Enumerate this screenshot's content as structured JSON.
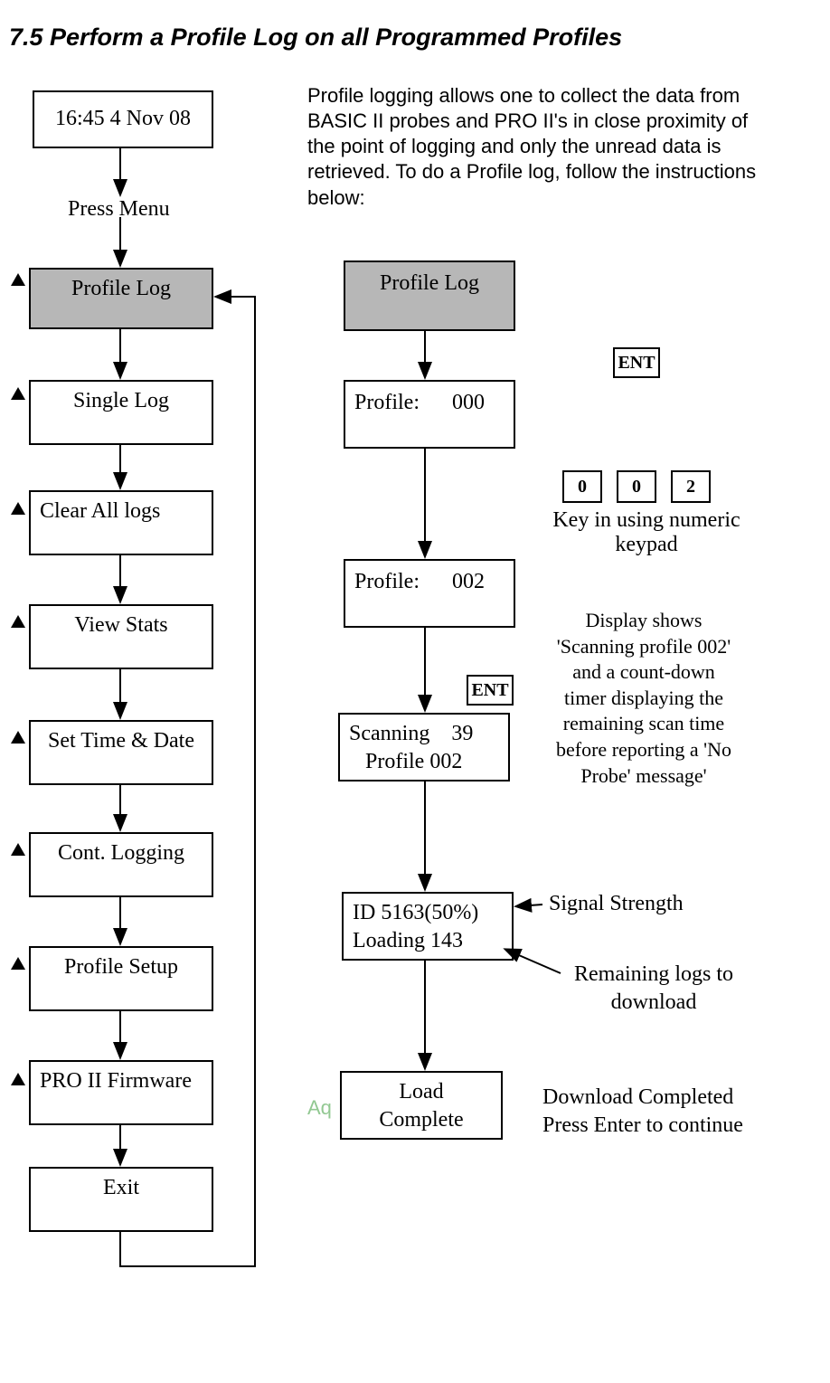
{
  "heading": "7.5  Perform a Profile Log on all Programmed Profiles",
  "intro": "Profile logging allows one to collect the data from BASIC II probes and PRO II's in close proximity of the point of logging and only the unread data is retrieved.  To do a Profile log, follow the instructions below:",
  "left": {
    "time_box": "16:45  4 Nov 08",
    "press_menu": "Press Menu",
    "items": [
      "Profile Log",
      "Single Log",
      "Clear All logs",
      "View Stats",
      "Set Time & Date",
      "Cont. Logging",
      "Profile Setup",
      "PRO II Firmware",
      "Exit"
    ]
  },
  "right": {
    "profile_log": "Profile Log",
    "profile_000_label": "Profile:",
    "profile_000_value": "000",
    "profile_002_label": "Profile:",
    "profile_002_value": "002",
    "scanning_line1_a": "Scanning",
    "scanning_line1_b": "39",
    "scanning_line2": "Profile 002",
    "id_line1": "ID 5163(50%)",
    "id_line2": "Loading  143",
    "load_line1": "Load",
    "load_line2": "Complete",
    "ent": "ENT",
    "keypad": [
      "0",
      "0",
      "2"
    ],
    "keypad_caption_l1": "Key in using numeric",
    "keypad_caption_l2": "keypad",
    "scan_note_l1": "Display shows",
    "scan_note_l2": "'Scanning profile 002'",
    "scan_note_l3": "and a count-down",
    "scan_note_l4": "timer displaying the",
    "scan_note_l5": "remaining scan time",
    "scan_note_l6": "before reporting a 'No",
    "scan_note_l7": "Probe'  message'",
    "signal_strength": "Signal Strength",
    "remaining_l1": "Remaining  logs to",
    "remaining_l2": "download",
    "done_l1": "Download Completed",
    "done_l2": "Press Enter to continue",
    "watermark": "Aq"
  }
}
